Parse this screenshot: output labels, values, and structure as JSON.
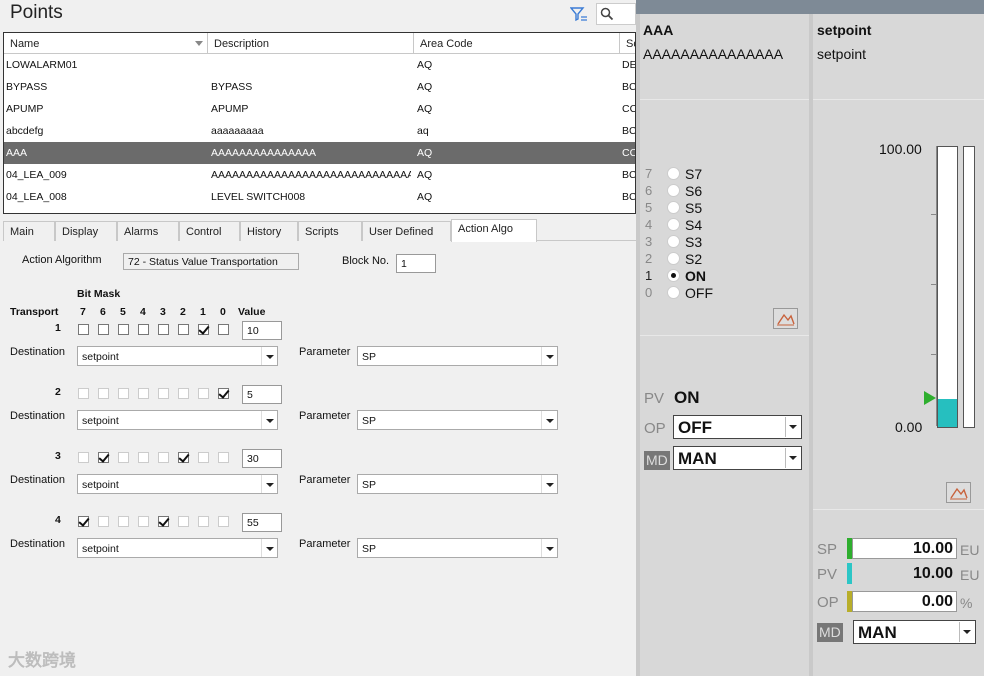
{
  "title": "Points",
  "table": {
    "columns": [
      "Name",
      "Description",
      "Area Code",
      "Sc"
    ],
    "rows": [
      {
        "name": "LOWALARM01",
        "description": "",
        "area": "AQ",
        "sc": "DE"
      },
      {
        "name": "BYPASS",
        "description": "BYPASS",
        "area": "AQ",
        "sc": "BC"
      },
      {
        "name": "APUMP",
        "description": "APUMP",
        "area": "AQ",
        "sc": "CC"
      },
      {
        "name": "abcdefg",
        "description": "aaaaaaaaa",
        "area": "aq",
        "sc": "BC"
      },
      {
        "name": "AAA",
        "description": "AAAAAAAAAAAAAAA",
        "area": "AQ",
        "sc": "CC"
      },
      {
        "name": "04_LEA_009",
        "description": "AAAAAAAAAAAAAAAAAAAAAAAAAAAAAAA...",
        "area": "AQ",
        "sc": "BC"
      },
      {
        "name": "04_LEA_008",
        "description": "LEVEL SWITCH008",
        "area": "AQ",
        "sc": "BC"
      }
    ],
    "selected_index": 4
  },
  "tabs": [
    "Main",
    "Display",
    "Alarms",
    "Control",
    "History",
    "Scripts",
    "User Defined",
    "Action Algo"
  ],
  "active_tab": "Action Algo",
  "form": {
    "algo_label": "Action Algorithm",
    "algo_value": "72 - Status Value Transportation",
    "block_label": "Block No.",
    "block_value": "1",
    "bitmask_label": "Bit Mask",
    "transport_label": "Transport",
    "bit_headers": [
      "7",
      "6",
      "5",
      "4",
      "3",
      "2",
      "1",
      "0"
    ],
    "value_label": "Value",
    "destination_label": "Destination",
    "parameter_label": "Parameter",
    "transports": [
      {
        "index": "1",
        "bits": [
          false,
          false,
          false,
          false,
          false,
          false,
          true,
          false
        ],
        "value": "10",
        "destination": "setpoint",
        "parameter": "SP"
      },
      {
        "index": "2",
        "bits": [
          false,
          false,
          false,
          false,
          false,
          false,
          false,
          true
        ],
        "value": "5",
        "destination": "setpoint",
        "parameter": "SP"
      },
      {
        "index": "3",
        "bits": [
          false,
          true,
          false,
          false,
          false,
          true,
          false,
          false
        ],
        "value": "30",
        "destination": "setpoint",
        "parameter": "SP"
      },
      {
        "index": "4",
        "bits": [
          true,
          false,
          false,
          false,
          true,
          false,
          false,
          false
        ],
        "value": "55",
        "destination": "setpoint",
        "parameter": "SP"
      }
    ]
  },
  "watermark": "大数跨境",
  "faceplate_left": {
    "name": "AAA",
    "description": "AAAAAAAAAAAAAAA",
    "states": [
      {
        "num": "7",
        "label": "S7",
        "on": false
      },
      {
        "num": "6",
        "label": "S6",
        "on": false
      },
      {
        "num": "5",
        "label": "S5",
        "on": false
      },
      {
        "num": "4",
        "label": "S4",
        "on": false
      },
      {
        "num": "3",
        "label": "S3",
        "on": false
      },
      {
        "num": "2",
        "label": "S2",
        "on": false
      },
      {
        "num": "1",
        "label": "ON",
        "on": true
      },
      {
        "num": "0",
        "label": "OFF",
        "on": false
      }
    ],
    "pv_label": "PV",
    "pv_value": "ON",
    "op_label": "OP",
    "op_value": "OFF",
    "md_label": "MD",
    "md_value": "MAN"
  },
  "faceplate_right": {
    "name": "setpoint",
    "description": "setpoint",
    "scale_max": "100.00",
    "scale_min": "0.00",
    "bar_fill_fraction": 0.1,
    "sp_label": "SP",
    "sp_value": "10.00",
    "sp_unit": "EU",
    "pv_label": "PV",
    "pv_value": "10.00",
    "pv_unit": "EU",
    "op_label": "OP",
    "op_value": "0.00",
    "op_unit": "%",
    "md_label": "MD",
    "md_value": "MAN"
  },
  "colors": {
    "sp_marker": "#2eae2e",
    "pv_marker": "#2cc6c6",
    "op_marker": "#b8ae2a",
    "bar_fill": "#26bfbf",
    "selected_row": "#6b6b6b"
  }
}
